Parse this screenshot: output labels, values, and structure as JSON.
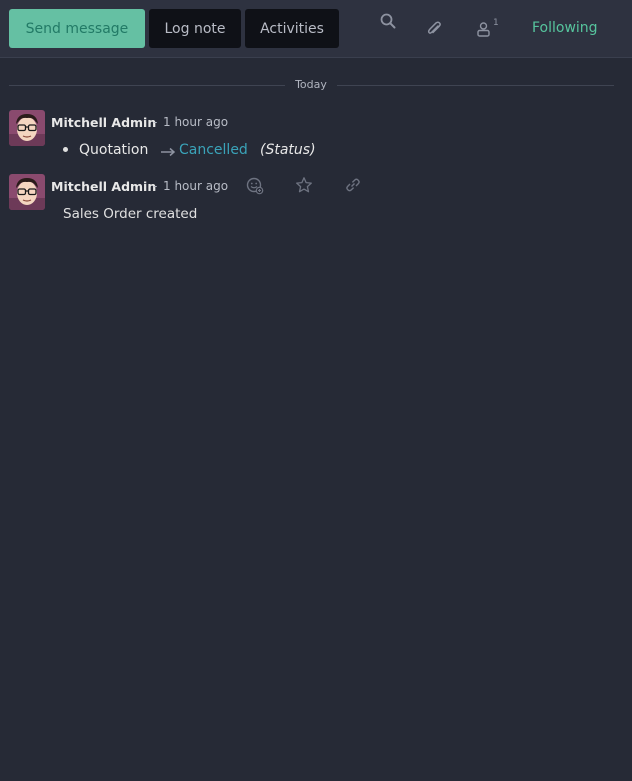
{
  "toolbar": {
    "send_message": "Send message",
    "log_note": "Log note",
    "activities": "Activities",
    "follower_count": "1",
    "following": "Following"
  },
  "thread": {
    "date_divider": "Today",
    "messages": [
      {
        "author": "Mitchell Admin",
        "separator": "-",
        "time": "1 hour ago",
        "tracking": {
          "field_label": "Quotation",
          "new_value": "Cancelled",
          "field_name": "(Status)"
        }
      },
      {
        "author": "Mitchell Admin",
        "separator": "-",
        "time": "1 hour ago",
        "body": "Sales Order created"
      }
    ]
  },
  "colors": {
    "background": "#262a36",
    "primary_button": "#65c0a3",
    "following": "#56c49d",
    "tracking_value": "#3aa3b9"
  },
  "icons": [
    "search-icon",
    "paperclip-icon",
    "user-icon",
    "arrow-right-icon",
    "add-reaction-icon",
    "star-icon",
    "link-icon"
  ]
}
